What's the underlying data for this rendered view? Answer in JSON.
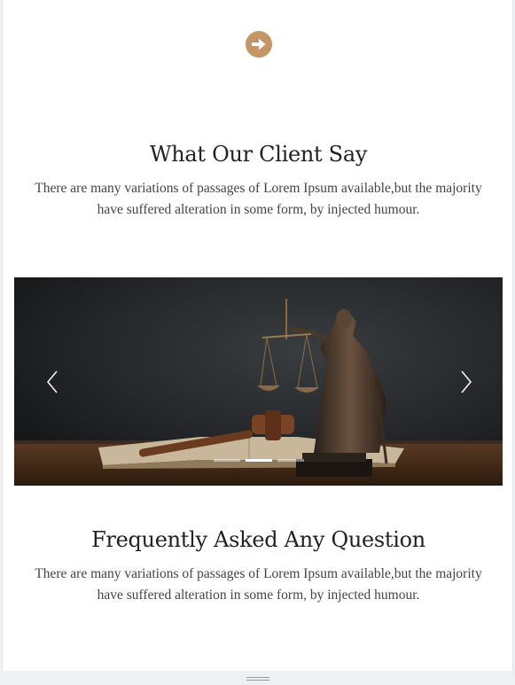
{
  "top_button": {
    "icon": "arrow-right-circle-icon",
    "color": "#c49666"
  },
  "testimonials": {
    "title": "What Our Client Say",
    "text": "There are many variations of passages of Lorem Ipsum available,but the majority have suffered alteration in some form, by injected humour."
  },
  "carousel": {
    "image": "lady-justice-statue-with-gavel-and-book",
    "prev_icon": "chevron-left-icon",
    "next_icon": "chevron-right-icon",
    "slide_count": 3,
    "active_slide": 2
  },
  "faq": {
    "title": "Frequently Asked Any Question",
    "text": "There are many variations of passages of Lorem Ipsum available,but the majority have suffered alteration in some form, by injected humour."
  },
  "colors": {
    "accent": "#c49666",
    "heading": "#222222",
    "body_text": "#444444"
  }
}
